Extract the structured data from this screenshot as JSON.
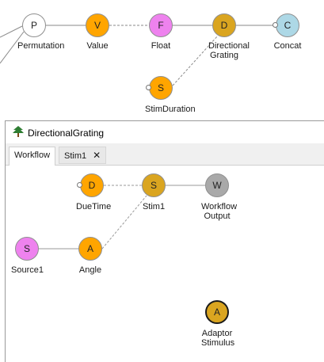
{
  "outer_graph": {
    "nodes": [
      {
        "id": "p",
        "letter": "P",
        "label": "Permutation",
        "color": "#ffffff"
      },
      {
        "id": "v",
        "letter": "V",
        "label": "Value",
        "color": "#ffa500"
      },
      {
        "id": "f",
        "letter": "F",
        "label": "Float",
        "color": "#ee82ee"
      },
      {
        "id": "d",
        "letter": "D",
        "label": "Directional\nGrating",
        "color": "#daa520"
      },
      {
        "id": "c",
        "letter": "C",
        "label": "Concat",
        "color": "#add8e6"
      },
      {
        "id": "s",
        "letter": "S",
        "label": "StimDuration",
        "color": "#ffa500"
      }
    ]
  },
  "window": {
    "title": "DirectionalGrating",
    "tabs": [
      {
        "label": "Workflow"
      },
      {
        "label": "Stim1",
        "close": "✕"
      }
    ]
  },
  "inner_graph": {
    "nodes": [
      {
        "id": "d",
        "letter": "D",
        "label": "DueTime",
        "color": "#ffa500"
      },
      {
        "id": "s",
        "letter": "S",
        "label": "Stim1",
        "color": "#daa520"
      },
      {
        "id": "w",
        "letter": "W",
        "label": "Workflow\nOutput",
        "color": "#a9a9a9"
      },
      {
        "id": "src",
        "letter": "S",
        "label": "Source1",
        "color": "#ee82ee"
      },
      {
        "id": "a",
        "letter": "A",
        "label": "Angle",
        "color": "#ffa500"
      },
      {
        "id": "ad",
        "letter": "A",
        "label": "Adaptor\nStimulus",
        "color": "#daa520"
      }
    ]
  },
  "colors": {
    "wire": "#9a9a9a",
    "tabstrip": "#f0f0f0"
  },
  "icons": {
    "window": "tree-icon",
    "tab_close": "close-icon"
  }
}
